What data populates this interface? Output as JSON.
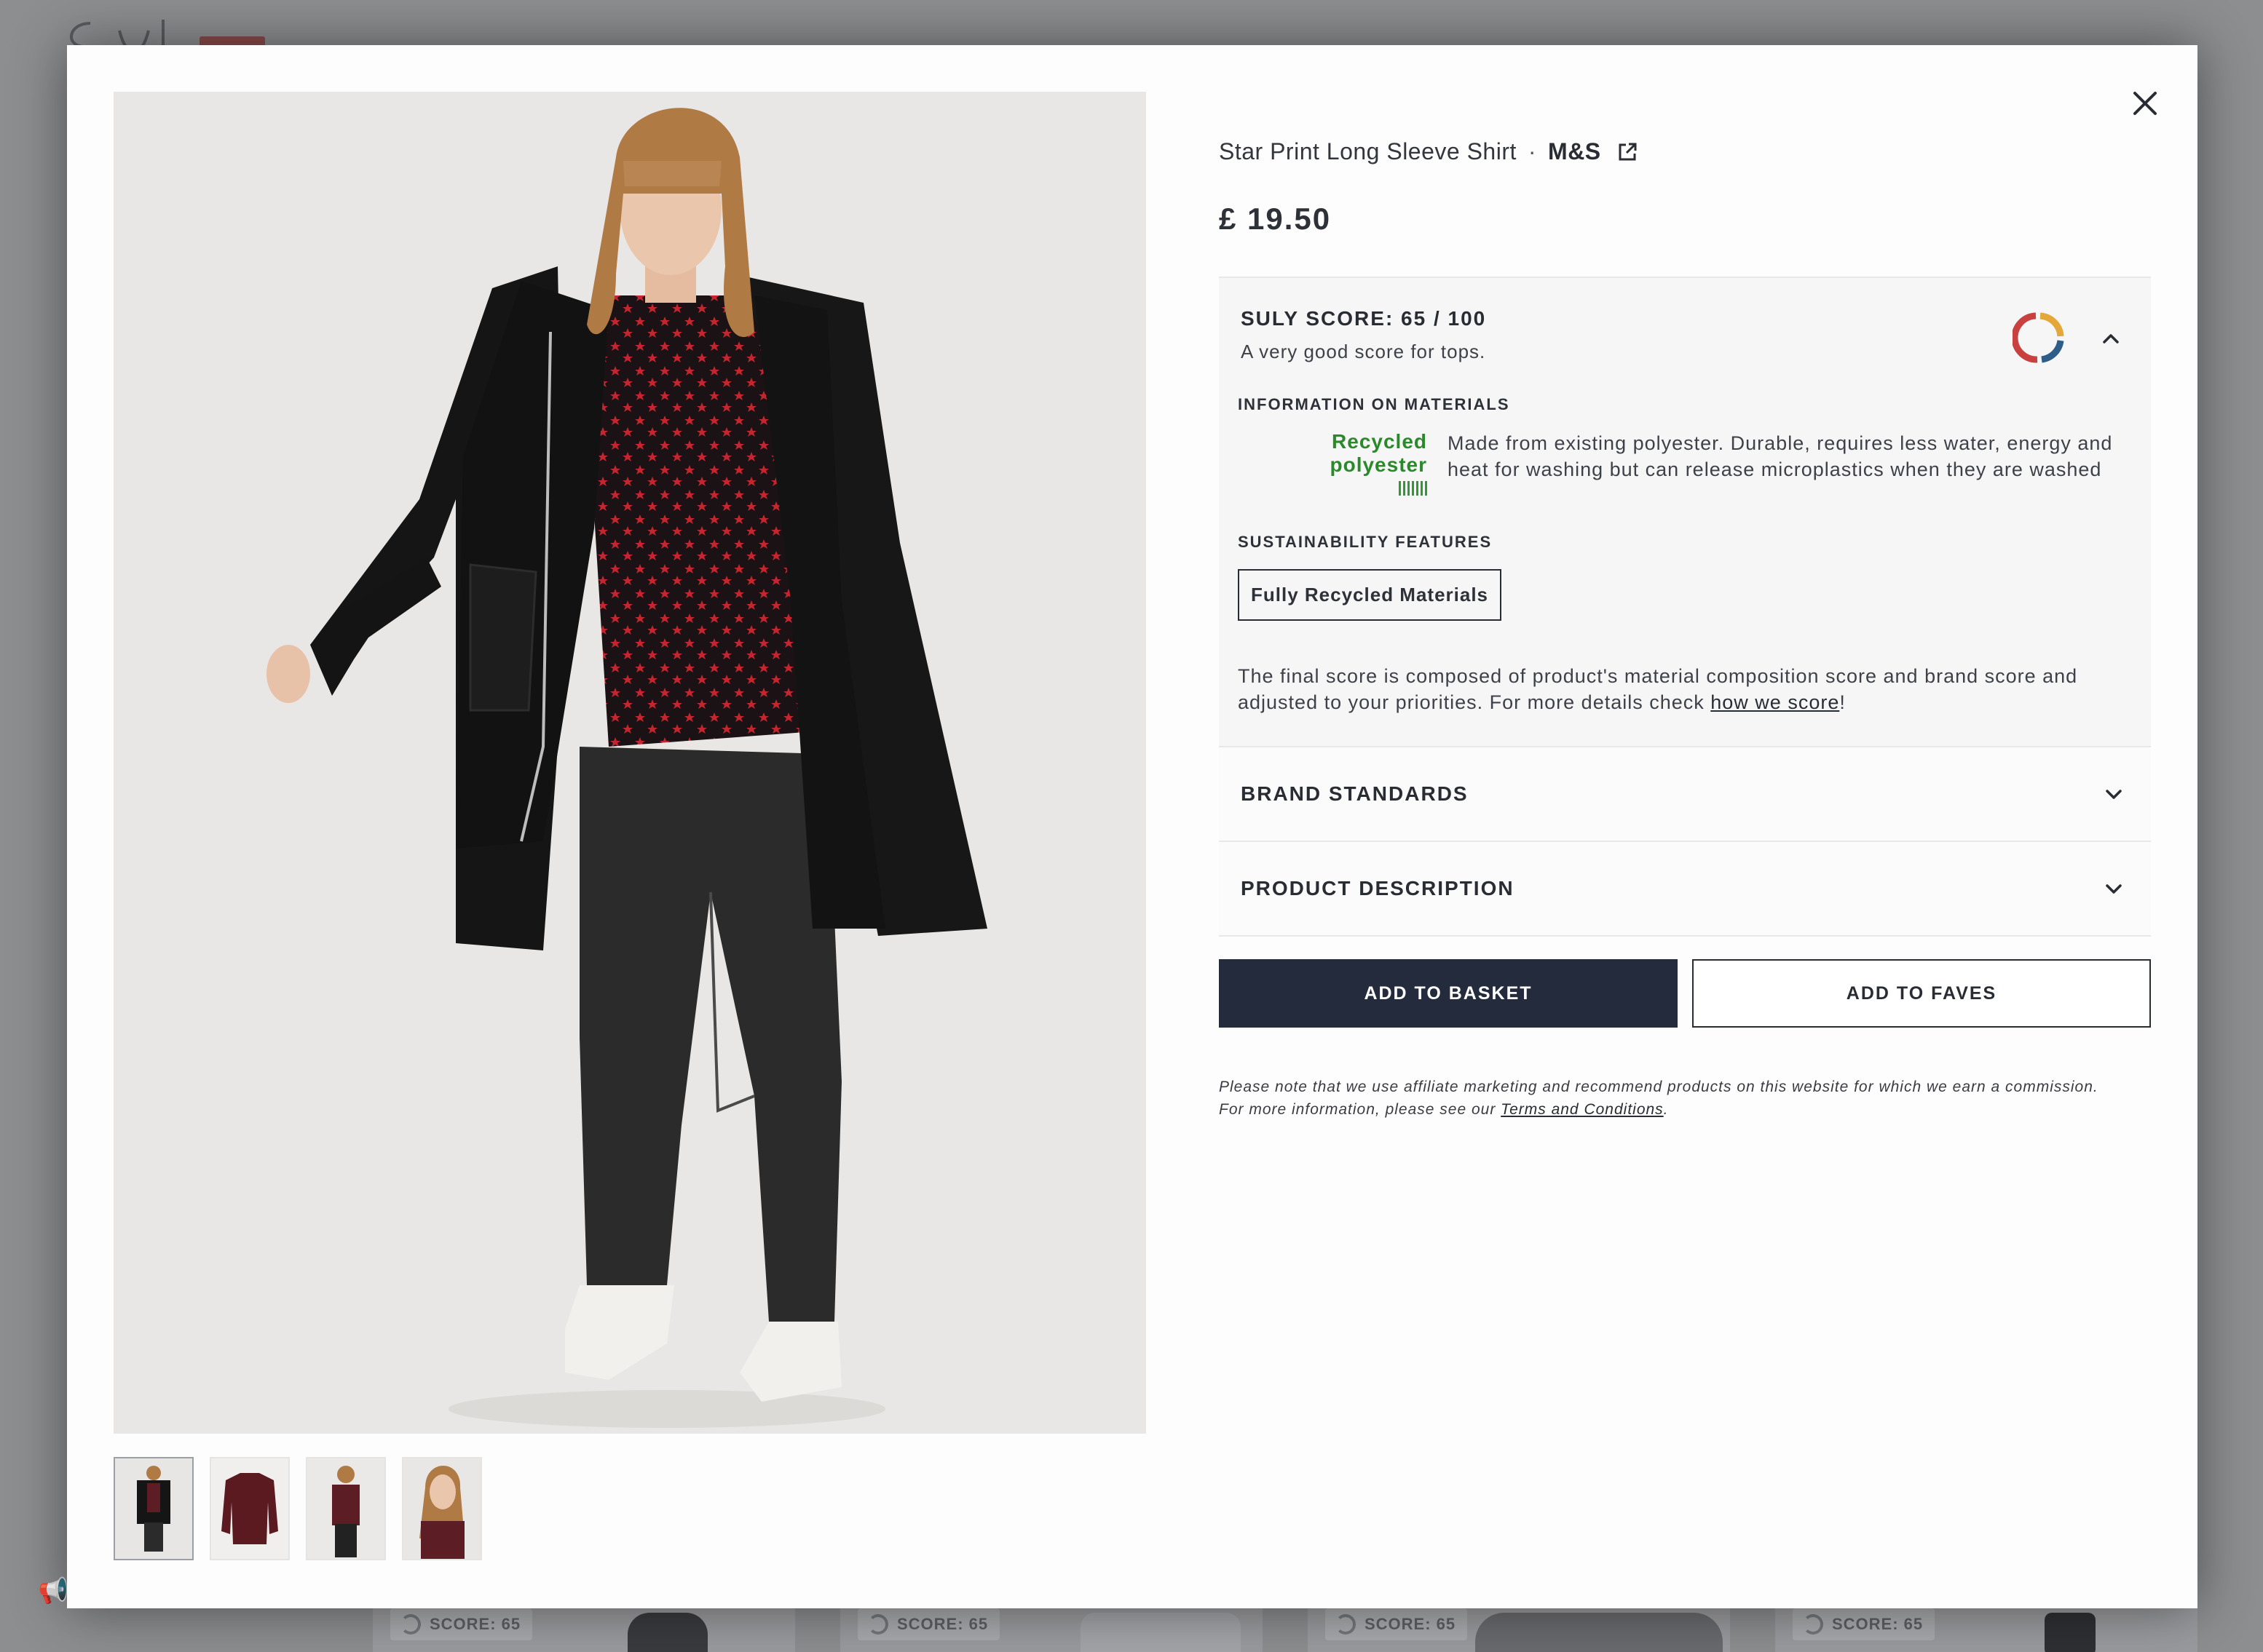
{
  "background": {
    "score_chips": [
      "SCORE: 65",
      "SCORE: 65",
      "SCORE: 65",
      "SCORE: 65"
    ]
  },
  "product": {
    "name": "Star Print Long Sleeve Shirt",
    "separator": "·",
    "brand": "M&S",
    "price": "£ 19.50",
    "thumbnail_count": 4
  },
  "score": {
    "title": "SULY SCORE: 65 / 100",
    "subtitle": "A very good score for tops.",
    "value": 65,
    "max": 100,
    "materials_heading": "INFORMATION ON MATERIALS",
    "material": {
      "name": "Recycled polyester",
      "description": "Made from existing polyester. Durable, requires less water, energy and heat for washing but can release microplastics when they are washed"
    },
    "features_heading": "SUSTAINABILITY FEATURES",
    "features": [
      "Fully Recycled Materials"
    ],
    "note_text": "The final score is composed of product's material composition score and brand score and adjusted to your priorities. For more details check ",
    "note_link": "how we score",
    "note_end": "!"
  },
  "sections": {
    "brand_standards": "BRAND STANDARDS",
    "product_description": "PRODUCT DESCRIPTION"
  },
  "actions": {
    "add_to_basket": "ADD TO BASKET",
    "add_to_faves": "ADD TO FAVES"
  },
  "disclaimer": {
    "text": "Please note that we use affiliate marketing and recommend products on this website for which we earn a commission. For more information, please see our ",
    "link": "Terms and Conditions",
    "end": "."
  },
  "colors": {
    "primary_button": "#232b3d",
    "material_green": "#2a8a2a",
    "score_ring": [
      "#e3a73a",
      "#2f5d8a",
      "#c8413f"
    ]
  },
  "icons": [
    "close-icon",
    "external-link-icon",
    "chevron-up-icon",
    "chevron-down-icon",
    "score-ring-icon",
    "speaker-icon"
  ]
}
